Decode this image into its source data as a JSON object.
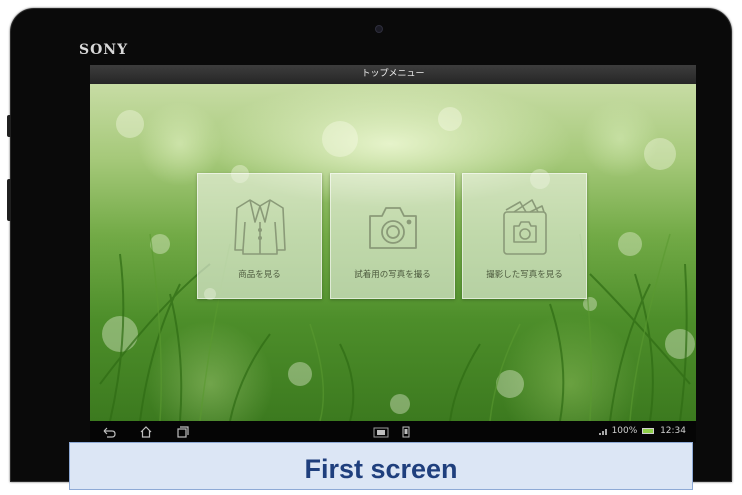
{
  "device": {
    "brand": "SONY"
  },
  "screen": {
    "title": "トップメニュー",
    "tiles": [
      {
        "label": "商品を見る",
        "icon": "jacket-icon"
      },
      {
        "label": "試着用の写真を撮る",
        "icon": "camera-icon"
      },
      {
        "label": "撮影した写真を見る",
        "icon": "photo-album-icon"
      }
    ]
  },
  "status_bar": {
    "battery_percent": "100%",
    "time": "12:34"
  },
  "caption": "First screen",
  "colors": {
    "tile_label": "#4d5a3e",
    "battery": "#8fd04a",
    "caption_text": "#1f3f7d",
    "caption_bg": "#dce6f5"
  }
}
